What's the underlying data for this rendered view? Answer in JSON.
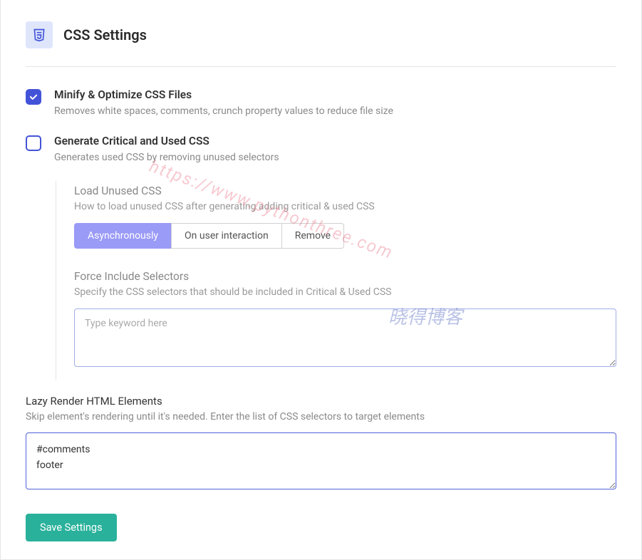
{
  "header": {
    "title": "CSS Settings"
  },
  "options": {
    "minify": {
      "title": "Minify & Optimize CSS Files",
      "desc": "Removes white spaces, comments, crunch property values to reduce file size",
      "checked": true
    },
    "critical": {
      "title": "Generate Critical and Used CSS",
      "desc": "Generates used CSS by removing unused selectors",
      "checked": false
    }
  },
  "load_unused": {
    "title": "Load Unused CSS",
    "desc": "How to load unused CSS after generating adding critical & used CSS",
    "buttons": {
      "async": "Asynchronously",
      "interaction": "On user interaction",
      "remove": "Remove"
    }
  },
  "force_include": {
    "title": "Force Include Selectors",
    "desc": "Specify the CSS selectors that should be included in Critical & Used CSS",
    "placeholder": "Type keyword here"
  },
  "lazy": {
    "title": "Lazy Render HTML Elements",
    "desc": "Skip element's rendering until it's needed. Enter the list of CSS selectors to target elements",
    "value": "#comments\nfooter"
  },
  "save_button": "Save Settings",
  "watermarks": {
    "url": "https://www.pythonthree.com",
    "name": "晓得博客"
  }
}
